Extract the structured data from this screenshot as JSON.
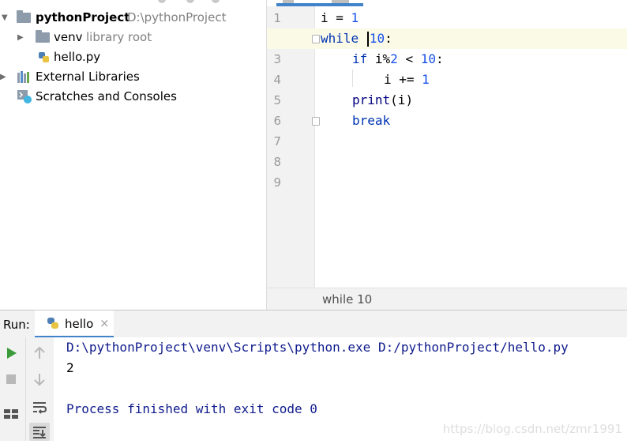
{
  "project_tree": {
    "root_name": "pythonProject",
    "root_path": "D:\\pythonProject",
    "venv_name": "venv",
    "venv_hint": "library root",
    "file_name": "hello.py",
    "external_libraries": "External Libraries",
    "scratches": "Scratches and Consoles"
  },
  "editor": {
    "line_numbers": [
      "1",
      "2",
      "3",
      "4",
      "5",
      "6",
      "7",
      "8",
      "9"
    ],
    "code": {
      "l1_a": "i = ",
      "l1_num": "1",
      "l2_kw": "while",
      "l2_num": "10",
      "l2_end": ":",
      "l3_kw": "if",
      "l3_mid": " i%",
      "l3_num1": "2",
      "l3_op": " < ",
      "l3_num2": "10",
      "l3_end": ":",
      "l4_a": "i += ",
      "l4_num": "1",
      "l5_fn": "print",
      "l5_rest": "(i)",
      "l6_kw": "break"
    },
    "breadcrumb": "while 10"
  },
  "run": {
    "label": "Run:",
    "tab_label": "hello",
    "tab_close": "×",
    "output": {
      "command": "D:\\pythonProject\\venv\\Scripts\\python.exe D:/pythonProject/hello.py",
      "result": "2",
      "finished": "Process finished with exit code 0"
    }
  },
  "watermark": "https://blog.csdn.net/zmr1991",
  "colors": {
    "keyword": "#0033b3",
    "number": "#1750eb",
    "console_text": "#0f1b8c",
    "run_green": "#3b9b3b",
    "tab_accent": "#4083c9"
  },
  "icons": [
    "folder-icon",
    "python-file-icon",
    "library-icon",
    "scratches-icon",
    "run-icon",
    "stop-icon",
    "layout-icon",
    "up-arrow-icon",
    "down-arrow-icon",
    "soft-wrap-icon",
    "scroll-to-end-icon",
    "close-icon"
  ]
}
